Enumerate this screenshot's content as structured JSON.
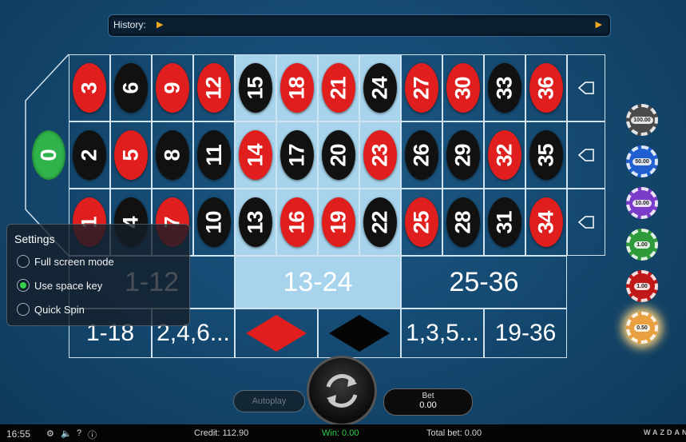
{
  "history": {
    "label": "History:"
  },
  "zero": "0",
  "rows": [
    [
      {
        "n": "3",
        "c": "red"
      },
      {
        "n": "6",
        "c": "black"
      },
      {
        "n": "9",
        "c": "red"
      },
      {
        "n": "12",
        "c": "red"
      },
      {
        "n": "15",
        "c": "black"
      },
      {
        "n": "18",
        "c": "red"
      },
      {
        "n": "21",
        "c": "red"
      },
      {
        "n": "24",
        "c": "black"
      },
      {
        "n": "27",
        "c": "red"
      },
      {
        "n": "30",
        "c": "red"
      },
      {
        "n": "33",
        "c": "black"
      },
      {
        "n": "36",
        "c": "red"
      }
    ],
    [
      {
        "n": "2",
        "c": "black"
      },
      {
        "n": "5",
        "c": "red"
      },
      {
        "n": "8",
        "c": "black"
      },
      {
        "n": "11",
        "c": "black"
      },
      {
        "n": "14",
        "c": "red"
      },
      {
        "n": "17",
        "c": "black"
      },
      {
        "n": "20",
        "c": "black"
      },
      {
        "n": "23",
        "c": "red"
      },
      {
        "n": "26",
        "c": "black"
      },
      {
        "n": "29",
        "c": "black"
      },
      {
        "n": "32",
        "c": "red"
      },
      {
        "n": "35",
        "c": "black"
      }
    ],
    [
      {
        "n": "1",
        "c": "red"
      },
      {
        "n": "4",
        "c": "black"
      },
      {
        "n": "7",
        "c": "red"
      },
      {
        "n": "10",
        "c": "black"
      },
      {
        "n": "13",
        "c": "black"
      },
      {
        "n": "16",
        "c": "red"
      },
      {
        "n": "19",
        "c": "red"
      },
      {
        "n": "22",
        "c": "black"
      },
      {
        "n": "25",
        "c": "red"
      },
      {
        "n": "28",
        "c": "black"
      },
      {
        "n": "31",
        "c": "black"
      },
      {
        "n": "34",
        "c": "red"
      }
    ]
  ],
  "highlighted_columns": [
    4,
    5,
    6,
    7
  ],
  "dozens": [
    "1-12",
    "13-24",
    "25-36"
  ],
  "highlighted_dozen": 1,
  "outside": [
    "1-18",
    "2,4,6...",
    "red",
    "black",
    "1,3,5...",
    "19-36"
  ],
  "chips": [
    {
      "label": "100.00",
      "color": "#4a4a4a"
    },
    {
      "label": "50.00",
      "color": "#1f5fd0"
    },
    {
      "label": "10.00",
      "color": "#7a3cc8"
    },
    {
      "label": "1.00",
      "color": "#2e9a3a"
    },
    {
      "label": "1.00",
      "color": "#c01818"
    },
    {
      "label": "0.50",
      "color": "#e8a040",
      "selected": true
    }
  ],
  "settings": {
    "title": "Settings",
    "options": [
      {
        "label": "Full screen mode",
        "checked": false
      },
      {
        "label": "Use space key",
        "checked": true
      },
      {
        "label": "Quick Spin",
        "checked": false
      }
    ]
  },
  "controls": {
    "autoplay": "Autoplay",
    "bet_label": "Bet",
    "bet_value": "0.00"
  },
  "status": {
    "time": "16:55",
    "credit": "Credit: 112.90",
    "win": "Win: 0.00",
    "total_bet": "Total bet: 0.00",
    "brand": "WAZDAN"
  },
  "colors": {
    "red": "#e01e1e",
    "black": "#111111",
    "green": "#2fb34a",
    "highlight": "#a7d4ec"
  }
}
